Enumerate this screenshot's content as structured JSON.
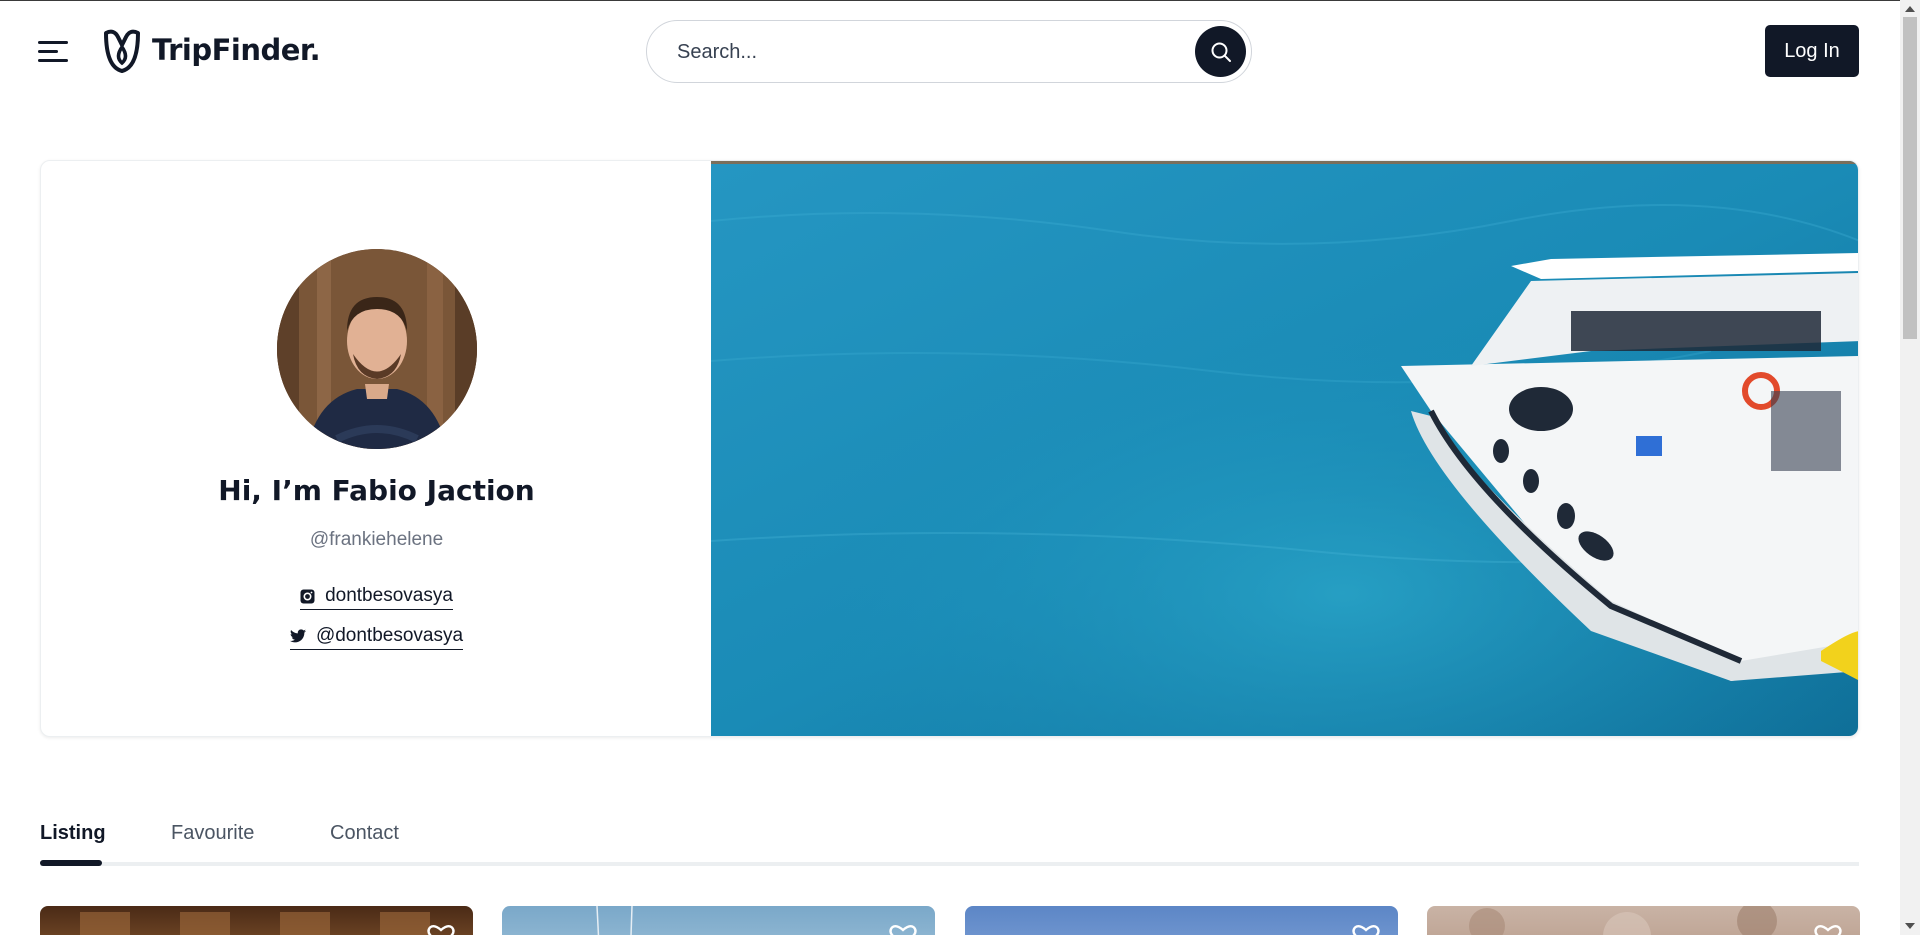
{
  "header": {
    "logo_text": "TripFinder.",
    "search_placeholder": "Search...",
    "login_label": "Log In"
  },
  "profile": {
    "name": "Hi, I’m Fabio Jaction",
    "handle": "@frankiehelene",
    "instagram": "dontbesovasya",
    "twitter": "@dontbesovasya"
  },
  "tabs": [
    {
      "label": "Listing",
      "active": true
    },
    {
      "label": "Favourite",
      "active": false
    },
    {
      "label": "Contact",
      "active": false
    }
  ],
  "icons": {
    "menu": "hamburger-icon",
    "logo": "tripfinder-logo-icon",
    "search": "search-icon",
    "instagram": "instagram-icon",
    "twitter": "twitter-icon",
    "favorite": "heart-icon"
  },
  "colors": {
    "primary": "#111827",
    "sea": "#1c8fb5",
    "tab_line": "#eceff1"
  }
}
